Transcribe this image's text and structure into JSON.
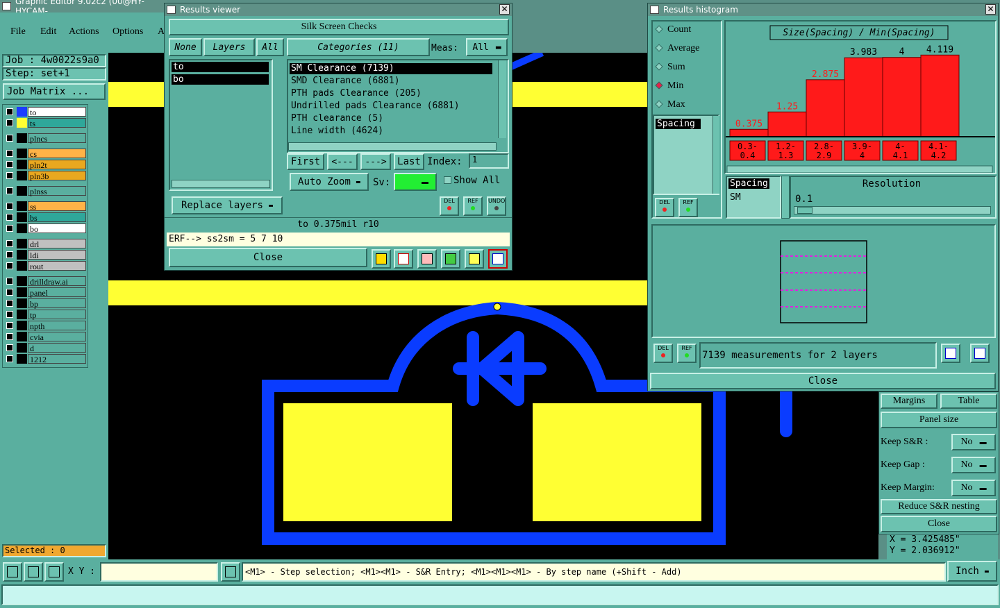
{
  "app": {
    "title": "Graphic Editor 9.02c2 (00@HY-HYCAM-"
  },
  "menu": [
    "File",
    "Edit",
    "Actions",
    "Options",
    "A"
  ],
  "job": {
    "job_line": "Job : 4w0022s9a0",
    "step_line": "Step: set+1",
    "matrix_btn": "Job Matrix ..."
  },
  "layers": [
    {
      "name": "to",
      "color": "#ffffff",
      "sw": "#1c3cff"
    },
    {
      "name": "ts",
      "color": "#2fa79a",
      "sw": "#ffff33"
    },
    {
      "name": "plncs",
      "color": "#5aaf9f",
      "sw": "#000"
    },
    {
      "name": "cs",
      "color": "#ffb347",
      "sw": "#000"
    },
    {
      "name": "pln2t",
      "color": "#e9a81f",
      "sw": "#000"
    },
    {
      "name": "pln3b",
      "color": "#e9a81f",
      "sw": "#000"
    },
    {
      "name": "plnss",
      "color": "#5aaf9f",
      "sw": "#000"
    },
    {
      "name": "ss",
      "color": "#ffb347",
      "sw": "#000"
    },
    {
      "name": "bs",
      "color": "#2fa79a",
      "sw": "#000"
    },
    {
      "name": "bo",
      "color": "#ffffff",
      "sw": "#000"
    },
    {
      "name": "drl",
      "color": "#c0c0c0",
      "sw": "#000"
    },
    {
      "name": "ldi",
      "color": "#c0c0c0",
      "sw": "#000"
    },
    {
      "name": "rout",
      "color": "#c0c0c0",
      "sw": "#000"
    },
    {
      "name": "drilldraw.ai",
      "color": "#5aaf9f",
      "sw": "#000"
    },
    {
      "name": "panel",
      "color": "#5aaf9f",
      "sw": "#000"
    },
    {
      "name": "bp",
      "color": "#5aaf9f",
      "sw": "#000"
    },
    {
      "name": "tp",
      "color": "#5aaf9f",
      "sw": "#000"
    },
    {
      "name": "npth",
      "color": "#5aaf9f",
      "sw": "#000"
    },
    {
      "name": "cvia",
      "color": "#5aaf9f",
      "sw": "#000"
    },
    {
      "name": "d",
      "color": "#5aaf9f",
      "sw": "#000"
    },
    {
      "name": "1212",
      "color": "#5aaf9f",
      "sw": "#000"
    }
  ],
  "selected": "Selected : 0",
  "viewer": {
    "title": "Results viewer",
    "header": "Silk Screen Checks",
    "none": "None",
    "layers": "Layers",
    "all": "All",
    "categories_btn": "Categories (11)",
    "meas_label": "Meas:",
    "meas_value": "All",
    "layer_list": [
      "to",
      "bo"
    ],
    "categories": [
      "SM Clearance (7139)",
      "SMD Clearance (6881)",
      "PTH pads Clearance (205)",
      "Undrilled pads Clearance (6881)",
      "PTH clearance (5)",
      "Line width (4624)"
    ],
    "first": "First",
    "prev": "<---",
    "next": "--->",
    "last": "Last",
    "index_label": "Index:",
    "index_value": "1",
    "auto_zoom": "Auto Zoom",
    "sv_label": "Sv:",
    "show_all": "Show All",
    "replace_layers": "Replace layers",
    "del": "DEL",
    "ref": "REF",
    "undo": "UNDO",
    "status": "to 0.375mil  r10",
    "erf": "ERF--> ss2sm = 5 7 10",
    "close": "Close"
  },
  "histogram": {
    "title": "Results histogram",
    "modes": [
      "Count",
      "Average",
      "Sum",
      "Min",
      "Max"
    ],
    "selected_mode": "Min",
    "chart_title": "Size(Spacing) / Min(Spacing)",
    "list_item": "Spacing",
    "spacing_label": "Spacing",
    "sm_label": "SM",
    "resolution_label": "Resolution",
    "resolution_value": "0.1",
    "measurements": "7139 measurements for 2 layers",
    "del": "DEL",
    "ref": "REF",
    "close": "Close"
  },
  "chart_data": {
    "type": "bar",
    "title": "Size(Spacing) / Min(Spacing)",
    "categories": [
      "0.3-0.4",
      "1.2-1.3",
      "2.8-2.9",
      "3.9-4",
      "4-4.1",
      "4.1-4.2"
    ],
    "values": [
      0.375,
      1.25,
      2.875,
      3.983,
      4,
      4.119
    ],
    "value_labels": [
      "0.375",
      "1.25",
      "2.875",
      "3.983",
      "4",
      "4.119"
    ],
    "label_colors": [
      "#ff1a1a",
      "#ff1a1a",
      "#ff1a1a",
      "#000000",
      "#000000",
      "#000000"
    ],
    "bin_top": [
      "0.3-",
      "1.2-",
      "2.8-",
      "3.9-",
      "4-",
      "4.1-"
    ],
    "bin_bottom": [
      "0.4",
      "1.3",
      "2.9",
      "4",
      "4.1",
      "4.2"
    ],
    "ylim": [
      0,
      4.2
    ]
  },
  "panelize": {
    "margins": "Margins",
    "table": "Table",
    "panel_size": "Panel size",
    "keep_sr": "Keep S&R  :",
    "keep_gap": "Keep Gap   :",
    "keep_margin": "Keep Margin:",
    "no": "No",
    "reduce": "Reduce S&R nesting",
    "close": "Close"
  },
  "coords": {
    "x": "X = 3.425485\"",
    "y": "Y = 2.036912\""
  },
  "bottom": {
    "xy_label": "X Y :",
    "hint": "<M1> - Step selection; <M1><M1> - S&R Entry; <M1><M1><M1> - By step name (+Shift - Add)",
    "unit": "Inch"
  },
  "colors": {
    "yellow": "#ffff33",
    "blue": "#0a3cff",
    "teal": "#5aaf9f",
    "red": "#ff1a1a"
  }
}
